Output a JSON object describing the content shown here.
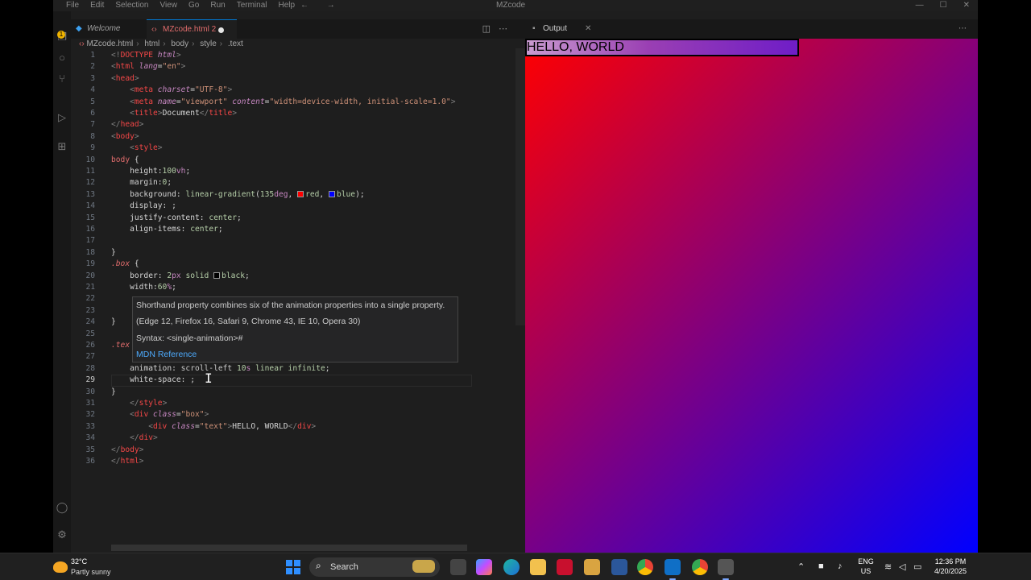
{
  "window": {
    "menus": [
      "File",
      "Edit",
      "Selection",
      "View",
      "Go",
      "Run",
      "Terminal",
      "Help"
    ],
    "nav_arrows": "← →",
    "title": "MZcode"
  },
  "tabs": {
    "welcome": "Welcome",
    "active": "MZcode.html 2"
  },
  "breadcrumb": [
    "MZcode.html",
    "html",
    "body",
    "style",
    ".text"
  ],
  "editor": {
    "current_line": 29,
    "lines": [
      {
        "n": "1",
        "html": "<span class='t-punc'>&lt;!</span><span class='t-tag'>DOCTYPE</span> <span class='t-attr'>html</span><span class='t-punc'>&gt;</span>"
      },
      {
        "n": "2",
        "html": "<span class='t-punc'>&lt;</span><span class='t-tag'>html</span> <span class='t-attr'>lang</span><span class='t-text'>=</span><span class='t-str'>\"en\"</span><span class='t-punc'>&gt;</span>"
      },
      {
        "n": "3",
        "html": "<span class='t-punc'>&lt;</span><span class='t-tag'>head</span><span class='t-punc'>&gt;</span>"
      },
      {
        "n": "4",
        "html": "    <span class='t-punc'>&lt;</span><span class='t-tag'>meta</span> <span class='t-attr'>charset</span><span class='t-text'>=</span><span class='t-str'>\"UTF-8\"</span><span class='t-punc'>&gt;</span>"
      },
      {
        "n": "5",
        "html": "    <span class='t-punc'>&lt;</span><span class='t-tag'>meta</span> <span class='t-attr'>name</span><span class='t-text'>=</span><span class='t-str'>\"viewport\"</span> <span class='t-attr'>content</span><span class='t-text'>=</span><span class='t-str'>\"width=device-width, initial-scale=1.0\"</span><span class='t-punc'>&gt;</span>"
      },
      {
        "n": "6",
        "html": "    <span class='t-punc'>&lt;</span><span class='t-tag'>title</span><span class='t-punc'>&gt;</span><span class='t-text'>Document</span><span class='t-punc'>&lt;/</span><span class='t-tag'>title</span><span class='t-punc'>&gt;</span>"
      },
      {
        "n": "7",
        "html": "<span class='t-punc'>&lt;/</span><span class='t-tag'>head</span><span class='t-punc'>&gt;</span>"
      },
      {
        "n": "8",
        "html": "<span class='t-punc'>&lt;</span><span class='t-tag'>body</span><span class='t-punc'>&gt;</span>"
      },
      {
        "n": "9",
        "html": "    <span class='t-punc'>&lt;</span><span class='t-tag'>style</span><span class='t-punc'>&gt;</span>"
      },
      {
        "n": "10",
        "html": "<span class='t-sel'>body</span> <span class='t-text'>{</span>"
      },
      {
        "n": "11",
        "html": "    <span class='t-prop'>height</span><span class='t-text'>:</span><span class='t-num'>100</span><span class='t-unit'>vh</span><span class='t-text'>;</span>"
      },
      {
        "n": "12",
        "html": "    <span class='t-prop'>margin</span><span class='t-text'>:</span><span class='t-num'>0</span><span class='t-text'>;</span>"
      },
      {
        "n": "13",
        "html": "    <span class='t-prop'>background</span><span class='t-text'>: </span><span class='t-val'>linear-gradient</span><span class='t-text'>(</span><span class='t-num'>135</span><span class='t-unit'>deg</span><span class='t-text'>, </span><span class='sw' style='background:#ff0000'></span><span class='t-val'>red</span><span class='t-text'>, </span><span class='sw' style='background:#0000ff'></span><span class='t-val'>blue</span><span class='t-text'>);</span>"
      },
      {
        "n": "14",
        "html": "    <span class='t-prop'>display</span><span class='t-text'>: ;</span>"
      },
      {
        "n": "15",
        "html": "    <span class='t-prop'>justify-content</span><span class='t-text'>: </span><span class='t-val'>center</span><span class='t-text'>;</span>"
      },
      {
        "n": "16",
        "html": "    <span class='t-prop'>align-items</span><span class='t-text'>: </span><span class='t-val'>center</span><span class='t-text'>;</span>"
      },
      {
        "n": "17",
        "html": ""
      },
      {
        "n": "18",
        "html": "<span class='t-text'>}</span>"
      },
      {
        "n": "19",
        "html": "<span class='t-cls'>.box</span> <span class='t-text'>{</span>"
      },
      {
        "n": "20",
        "html": "    <span class='t-prop'>border</span><span class='t-text'>: </span><span class='t-num'>2</span><span class='t-unit'>px</span> <span class='t-val'>solid</span> <span class='sw' style='background:#000'></span><span class='t-val'>black</span><span class='t-text'>;</span>"
      },
      {
        "n": "21",
        "html": "    <span class='t-prop'>width</span><span class='t-text'>:</span><span class='t-num'>60</span><span class='t-unit'>%</span><span class='t-text'>;</span>"
      },
      {
        "n": "22",
        "html": ""
      },
      {
        "n": "23",
        "html": ""
      },
      {
        "n": "24",
        "html": "<span class='t-text'>}</span>"
      },
      {
        "n": "25",
        "html": ""
      },
      {
        "n": "26",
        "html": "<span class='t-cls'>.tex</span>"
      },
      {
        "n": "27",
        "html": ""
      },
      {
        "n": "28",
        "html": "    <span class='t-prop'>animation</span><span class='t-text'>: </span><span class='t-kw'>scroll-left</span> <span class='t-num'>10</span><span class='t-unit'>s</span> <span class='t-val'>linear</span> <span class='t-val'>infinite</span><span class='t-text'>;</span>"
      },
      {
        "n": "29",
        "html": "    <span class='t-prop'>white-space</span><span class='t-text'>: ;</span>"
      },
      {
        "n": "30",
        "html": "<span class='t-text'>}</span>"
      },
      {
        "n": "31",
        "html": "    <span class='t-punc'>&lt;/</span><span class='t-tag'>style</span><span class='t-punc'>&gt;</span>"
      },
      {
        "n": "32",
        "html": "    <span class='t-punc'>&lt;</span><span class='t-tag'>div</span> <span class='t-attr'>class</span><span class='t-text'>=</span><span class='t-str'>\"box\"</span><span class='t-punc'>&gt;</span>"
      },
      {
        "n": "33",
        "html": "        <span class='t-punc'>&lt;</span><span class='t-tag'>div</span> <span class='t-attr'>class</span><span class='t-text'>=</span><span class='t-str'>\"text\"</span><span class='t-punc'>&gt;</span><span class='t-text'>HELLO, WORLD</span><span class='t-punc'>&lt;/</span><span class='t-tag'>div</span><span class='t-punc'>&gt;</span>"
      },
      {
        "n": "34",
        "html": "    <span class='t-punc'>&lt;/</span><span class='t-tag'>div</span><span class='t-punc'>&gt;</span>"
      },
      {
        "n": "35",
        "html": "<span class='t-punc'>&lt;/</span><span class='t-tag'>body</span><span class='t-punc'>&gt;</span>"
      },
      {
        "n": "36",
        "html": "<span class='t-punc'>&lt;/</span><span class='t-tag'>html</span><span class='t-punc'>&gt;</span>"
      }
    ]
  },
  "hover": {
    "description": "Shorthand property combines six of the animation properties into a single property.",
    "compat": "(Edge 12, Firefox 16, Safari 9, Chrome 43, IE 10, Opera 30)",
    "syntax": "Syntax: <single-animation>#",
    "link": "MDN Reference"
  },
  "output": {
    "tab_label": "Output",
    "box_text": "HELLO, WORLD"
  },
  "taskbar": {
    "temperature": "32°C",
    "condition": "Partly sunny",
    "search_label": "Search",
    "lang_line1": "ENG",
    "lang_line2": "US",
    "time": "12:36 PM",
    "date": "4/20/2025"
  },
  "colors": {
    "editor_bg": "#1e1e1e",
    "tab_accent": "#0078d4",
    "preview_gradient_from": "#ff0000",
    "preview_gradient_to": "#0000ff",
    "taskbar_bg": "#202020"
  }
}
